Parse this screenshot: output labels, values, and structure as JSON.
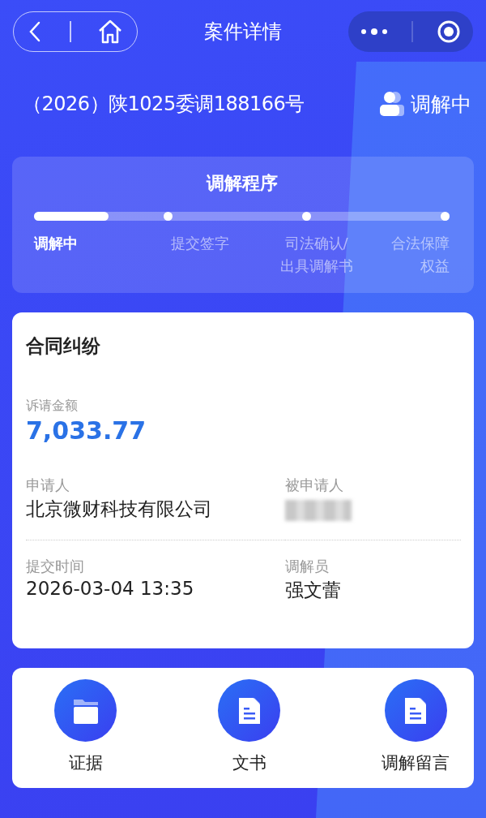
{
  "nav": {
    "title": "案件详情"
  },
  "case": {
    "number": "（2026）陕1025委调188166号",
    "status": "调解中"
  },
  "procedure": {
    "title": "调解程序",
    "level": 0.18,
    "steps": [
      {
        "label": "调解中",
        "selected": true
      },
      {
        "label": "提交签字",
        "selected": false
      },
      {
        "label": "司法确认/出具调解书",
        "selected": false
      },
      {
        "label": "合法保障权益",
        "selected": false
      }
    ]
  },
  "detail": {
    "type": "合同纠纷",
    "amount_label": "诉请金额",
    "amount": "7,033.77",
    "fields": [
      {
        "label": "申请人",
        "value": "北京微财科技有限公司",
        "redacted": false
      },
      {
        "label": "被申请人",
        "redacted": true
      },
      {
        "label": "提交时间",
        "value": "2026-03-04 13:35",
        "redacted": false
      },
      {
        "label": "调解员",
        "value": "强文蕾",
        "redacted": false
      }
    ]
  },
  "actions": [
    {
      "kind": "folder",
      "label": "证据"
    },
    {
      "kind": "document",
      "label": "文书"
    },
    {
      "kind": "document",
      "label": "调解留言"
    }
  ]
}
